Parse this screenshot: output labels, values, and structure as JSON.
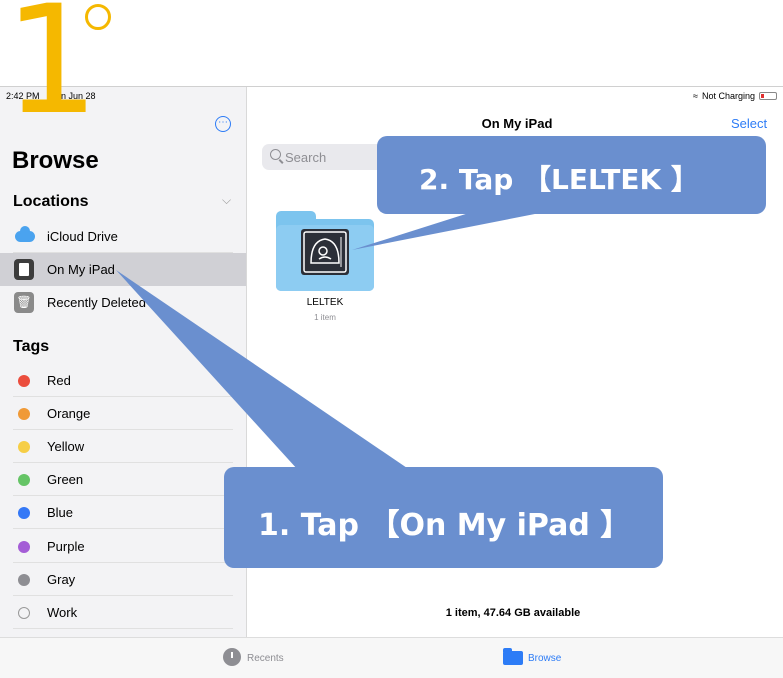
{
  "step": {
    "number": "1"
  },
  "status_bar": {
    "time": "2:42 PM",
    "date": "Sun Jun 28",
    "charging": "Not Charging"
  },
  "sidebar": {
    "title": "Browse",
    "locations_heading": "Locations",
    "locations": [
      {
        "label": "iCloud Drive",
        "icon": "icloud-icon"
      },
      {
        "label": "On My iPad",
        "icon": "ipad-icon",
        "selected": true
      },
      {
        "label": "Recently Deleted",
        "icon": "trash-icon"
      }
    ],
    "tags_heading": "Tags",
    "tags": [
      {
        "label": "Red",
        "color": "#EB4D3D"
      },
      {
        "label": "Orange",
        "color": "#F09A37"
      },
      {
        "label": "Yellow",
        "color": "#F6CE46"
      },
      {
        "label": "Green",
        "color": "#65C466"
      },
      {
        "label": "Blue",
        "color": "#3478F6"
      },
      {
        "label": "Purple",
        "color": "#A45DD6"
      },
      {
        "label": "Gray",
        "color": "#8E8E93"
      },
      {
        "label": "Work",
        "color": "none"
      }
    ]
  },
  "main": {
    "nav_title": "On My iPad",
    "select_label": "Select",
    "search_placeholder": "Search",
    "folder": {
      "name": "LELTEK",
      "count": "1 item",
      "icon": "ultrasound-folder-icon"
    },
    "storage": "1 item, 47.64 GB available"
  },
  "tab_bar": {
    "recents": "Recents",
    "browse": "Browse"
  },
  "callouts": {
    "step1": "1. Tap 【On My iPad 】",
    "step2": "2. Tap 【LELTEK 】"
  },
  "colors": {
    "accent": "#2D7CF6",
    "step_number": "#F5B800",
    "callout": "#6A8FCF"
  }
}
